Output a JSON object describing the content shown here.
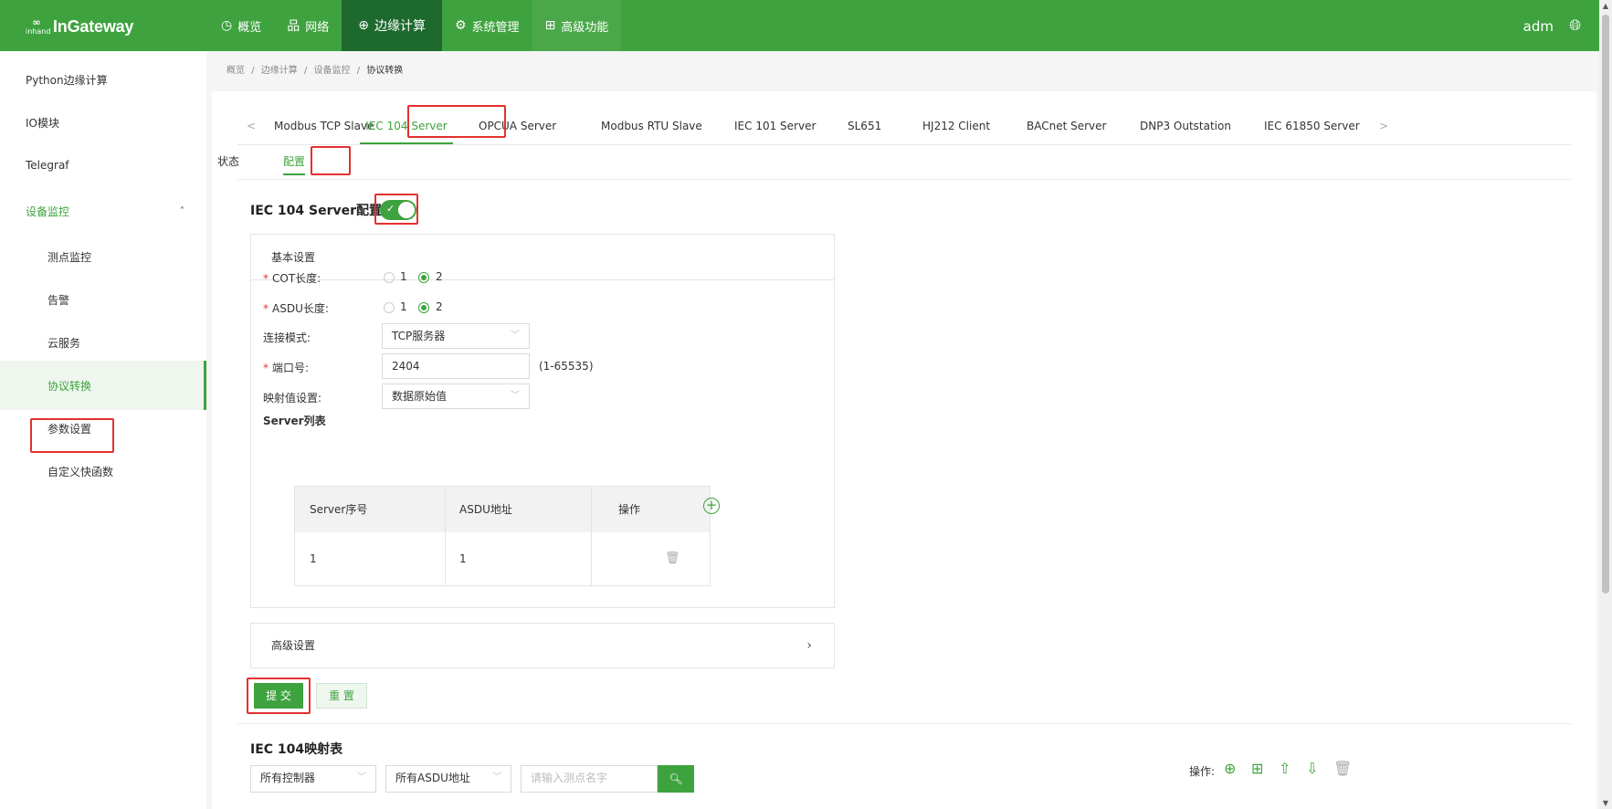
{
  "app": {
    "logo_mark": "inhand",
    "logo_name": "InGateway",
    "user": "adm"
  },
  "nav": [
    {
      "icon": "dashboard-icon",
      "glyph": "◷",
      "label": "概览"
    },
    {
      "icon": "network-icon",
      "glyph": "品",
      "label": "网络"
    },
    {
      "icon": "edge-computing-icon",
      "glyph": "⊕",
      "label": "边缘计算"
    },
    {
      "icon": "gear-icon",
      "glyph": "⚙",
      "label": "系统管理"
    },
    {
      "icon": "grid-icon",
      "glyph": "⊞",
      "label": "高级功能"
    }
  ],
  "sidebar": {
    "items": [
      {
        "label": "Python边缘计算"
      },
      {
        "label": "IO模块"
      },
      {
        "label": "Telegraf"
      },
      {
        "label": "设备监控"
      },
      {
        "label": "测点监控"
      },
      {
        "label": "告警"
      },
      {
        "label": "云服务"
      },
      {
        "label": "协议转换"
      },
      {
        "label": "参数设置"
      },
      {
        "label": "自定义快函数"
      }
    ]
  },
  "breadcrumb": {
    "p1": "概览",
    "p2": "边缘计算",
    "p3": "设备监控",
    "current": "协议转换",
    "sep": "/"
  },
  "tabs": [
    {
      "label": "Modbus TCP Slave"
    },
    {
      "label": "IEC 104 Server"
    },
    {
      "label": "OPCUA Server"
    },
    {
      "label": "Modbus RTU Slave"
    },
    {
      "label": "IEC 101 Server"
    },
    {
      "label": "SL651"
    },
    {
      "label": "HJ212 Client"
    },
    {
      "label": "BACnet Server"
    },
    {
      "label": "DNP3 Outstation"
    },
    {
      "label": "IEC 61850 Server"
    }
  ],
  "subtabs": {
    "status": "状态",
    "config": "配置"
  },
  "section": {
    "title": "IEC 104 Server配置",
    "enabled": true
  },
  "basic": {
    "title": "基本设置",
    "cot_label": "COT长度:",
    "asdu_label": "ASDU长度:",
    "opt1": "1",
    "opt2": "2",
    "mode_label": "连接模式:",
    "mode_value": "TCP服务器",
    "port_label": "端口号:",
    "port_value": "2404",
    "port_hint": "(1-65535)",
    "map_label": "映射值设置:",
    "map_value": "数据原始值",
    "server_list_label": "Server列表"
  },
  "server_table": {
    "headers": [
      "Server序号",
      "ASDU地址",
      "操作"
    ],
    "rows": [
      [
        "1",
        "1"
      ]
    ]
  },
  "advanced": {
    "title": "高级设置"
  },
  "buttons": {
    "submit": "提 交",
    "reset": "重 置"
  },
  "mapping": {
    "title": "IEC 104映射表",
    "controller_filter": "所有控制器",
    "asdu_filter": "所有ASDU地址",
    "search_placeholder": "请输入测点名字",
    "ops_label": "操作:"
  },
  "colors": {
    "brand": "#3ea33e",
    "brand_dark": "#1e6a2e",
    "highlight": "#e53030"
  }
}
